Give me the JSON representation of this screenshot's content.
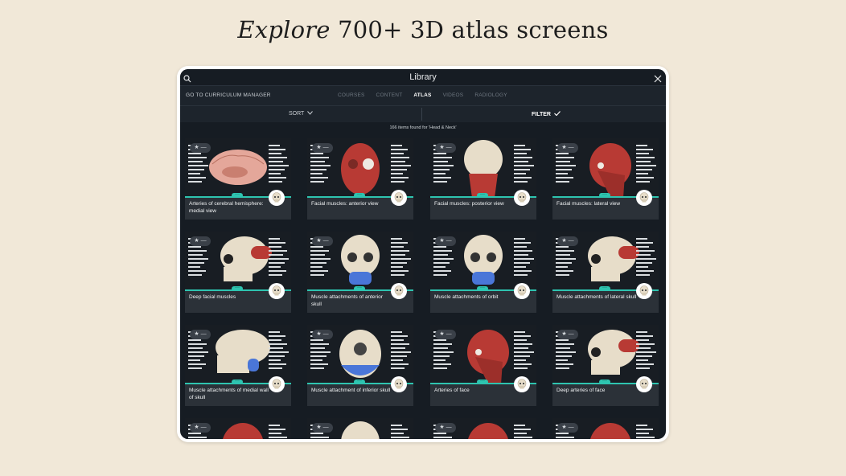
{
  "headline": {
    "italic": "Explore",
    "rest": " 700+ 3D atlas screens"
  },
  "app": {
    "title": "Library",
    "icons": {
      "search": "search-icon",
      "close": "close-icon",
      "sort": "chevron-down-icon",
      "filter": "check-icon",
      "favorite": "star-icon",
      "more": "more-dots-icon",
      "skull": "skull-icon"
    },
    "curriculum_link": "GO TO CURRICULUM MANAGER",
    "tabs": [
      {
        "label": "COURSES"
      },
      {
        "label": "CONTENT"
      },
      {
        "label": "ATLAS"
      },
      {
        "label": "VIDEOS"
      },
      {
        "label": "RADIOLOGY"
      }
    ],
    "active_tab": "ATLAS",
    "sort_label": "SORT",
    "filter_label": "FILTER",
    "results_text": "166 items found for 'Head & Neck'",
    "cards": [
      {
        "label": "Arteries of cerebral hemisphere: medial view"
      },
      {
        "label": "Facial muscles: anterior view"
      },
      {
        "label": "Facial muscles: posterior view"
      },
      {
        "label": "Facial muscles: lateral view"
      },
      {
        "label": "Deep facial muscles"
      },
      {
        "label": "Muscle attachments of anterior skull"
      },
      {
        "label": "Muscle attachments of orbit"
      },
      {
        "label": "Muscle attachments of lateral skull"
      },
      {
        "label": "Muscle attachments of medial wall of skull"
      },
      {
        "label": "Muscle attachment of inferior skull"
      },
      {
        "label": "Arteries of face"
      },
      {
        "label": "Deep arteries of face"
      },
      {
        "label": ""
      },
      {
        "label": ""
      },
      {
        "label": ""
      },
      {
        "label": ""
      }
    ],
    "colors": {
      "accent": "#2ec4b0",
      "background": "#161c23",
      "card": "#2b3138",
      "page": "#f1e8d8"
    }
  }
}
